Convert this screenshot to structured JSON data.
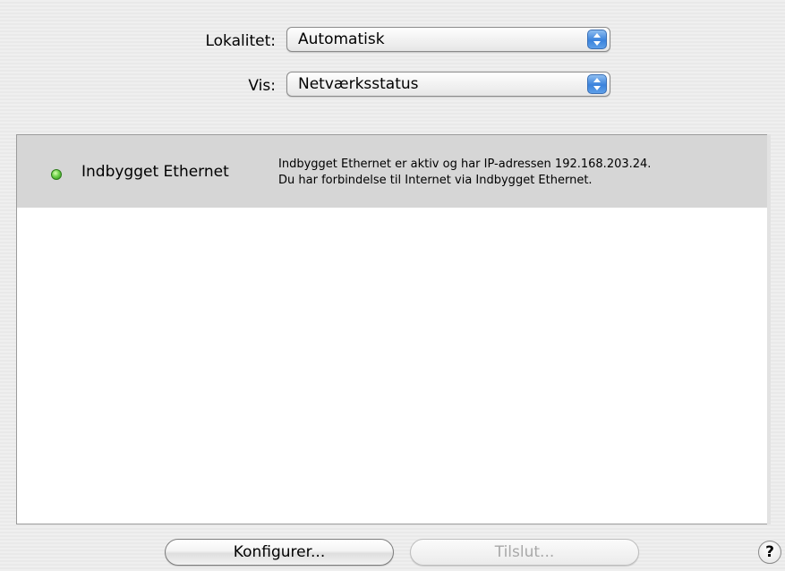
{
  "location": {
    "label": "Lokalitet:",
    "value": "Automatisk"
  },
  "show": {
    "label": "Vis:",
    "value": "Netværksstatus"
  },
  "services": [
    {
      "name": "Indbygget Ethernet",
      "status": "connected",
      "status_color": "#4cbf2f",
      "description_line1": "Indbygget Ethernet er aktiv og har IP-adressen 192.168.203.24.",
      "description_line2": "Du har forbindelse til Internet via Indbygget Ethernet."
    }
  ],
  "buttons": {
    "configure_label": "Konfigurer...",
    "connect_label": "Tilslut...",
    "help_label": "?"
  },
  "colors": {
    "selected_row": "#d6d6d6",
    "popup_arrow_blue": "#3b83dc"
  }
}
